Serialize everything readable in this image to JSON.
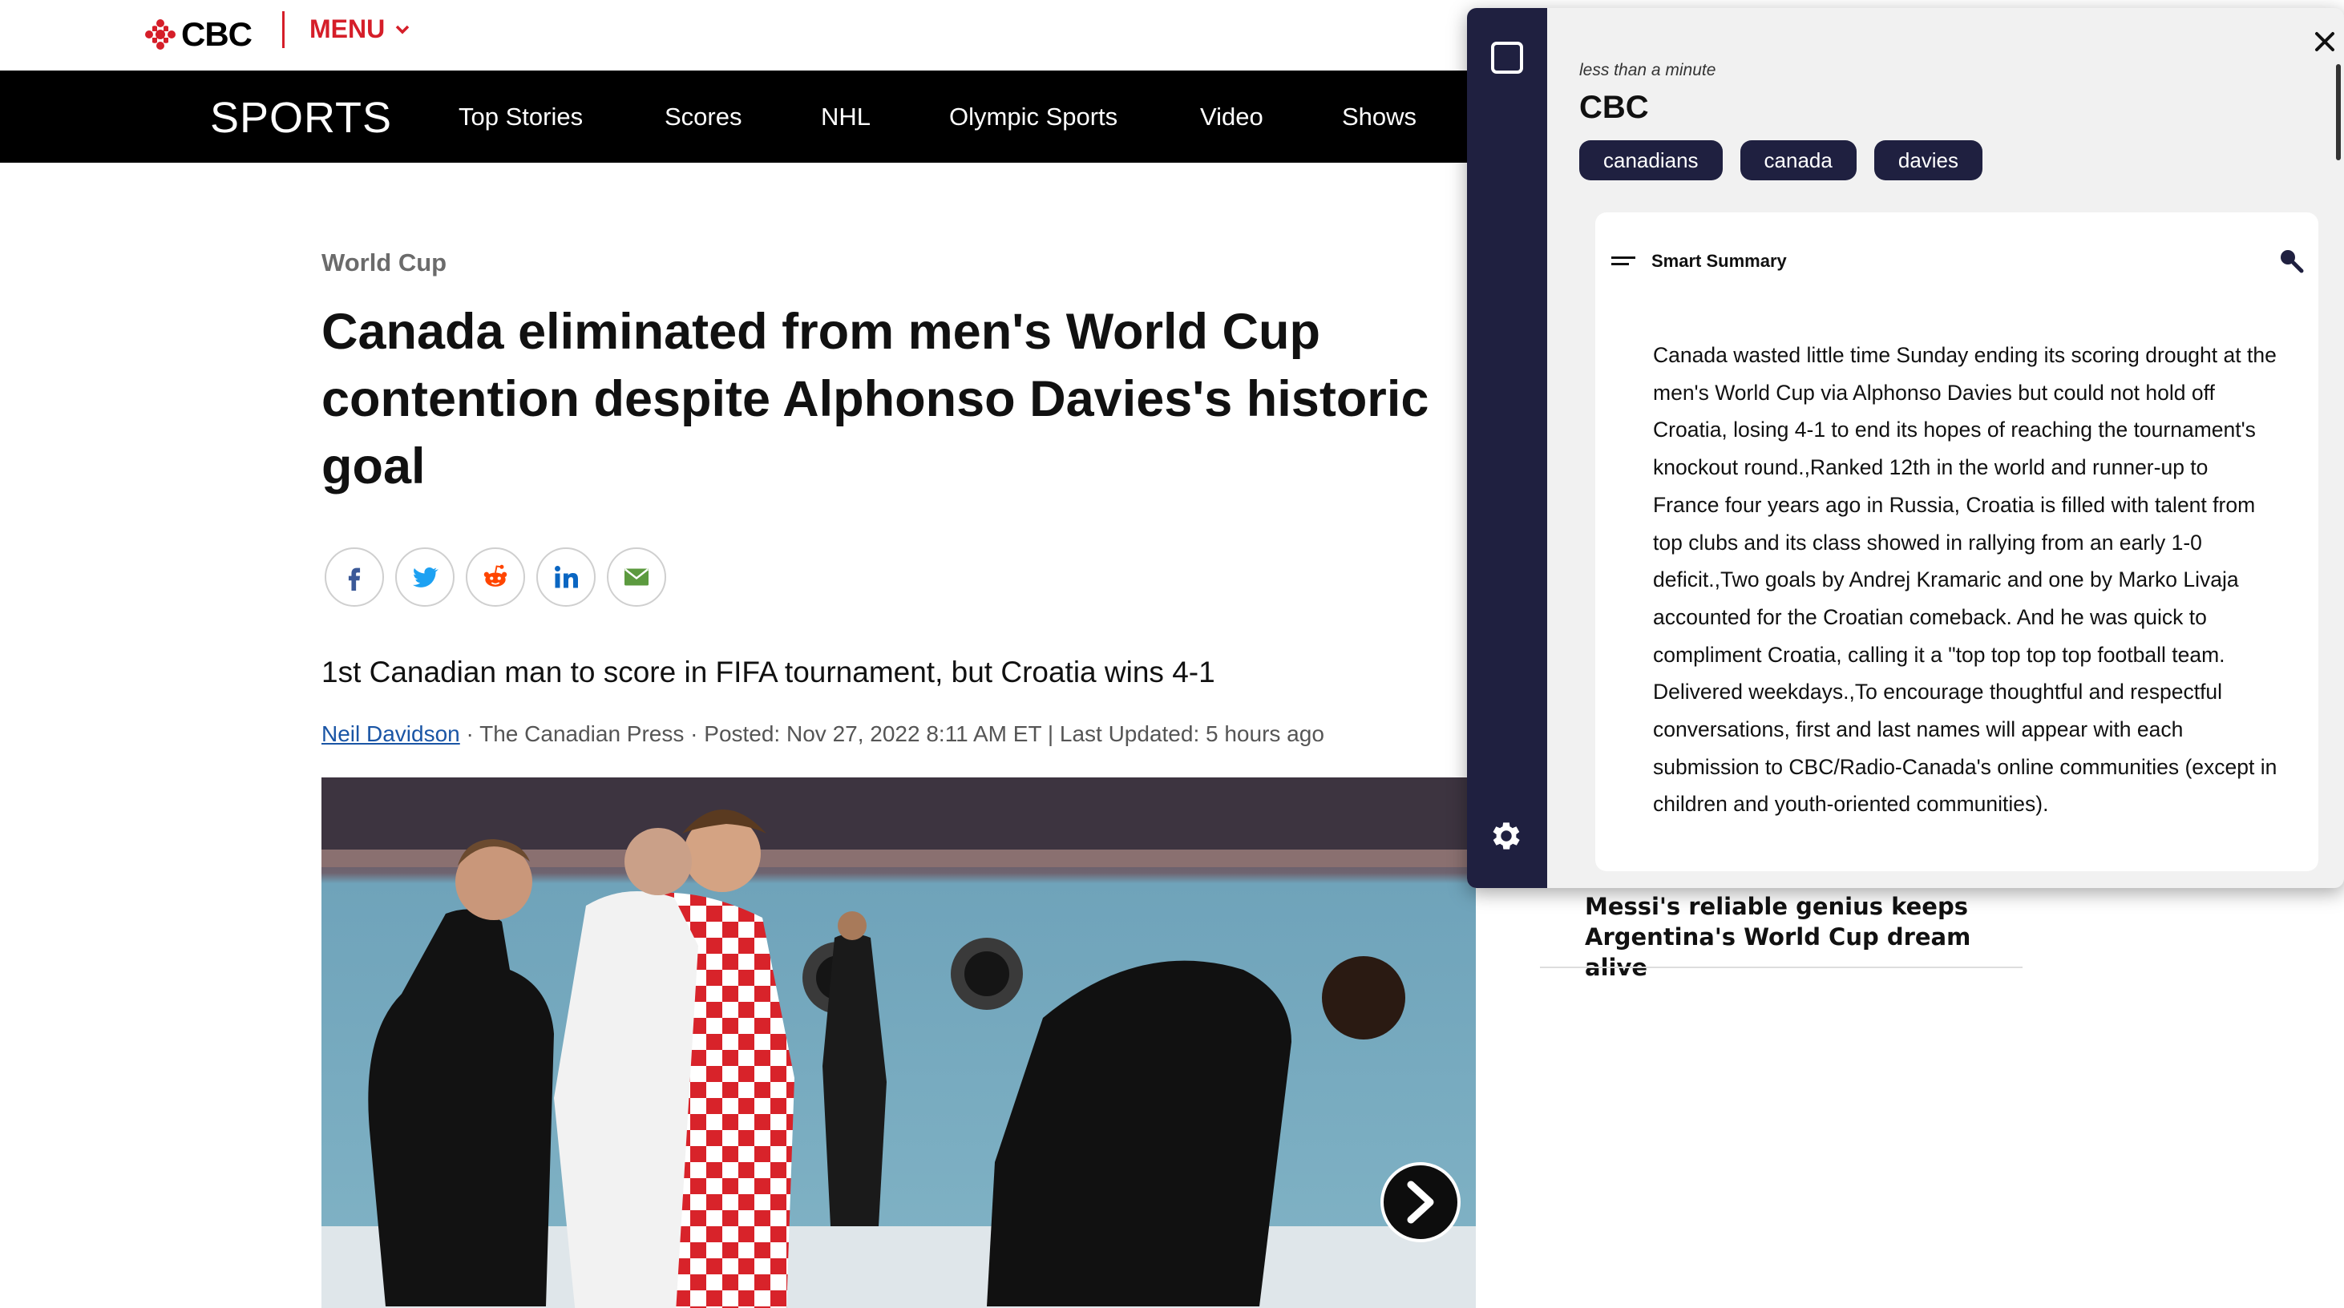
{
  "header": {
    "logo_text": "CBC",
    "menu_label": "MENU"
  },
  "nav": {
    "section_title": "SPORTS",
    "items": [
      "Top Stories",
      "Scores",
      "NHL",
      "Olympic Sports",
      "Video",
      "Shows"
    ]
  },
  "article": {
    "kicker": "World Cup",
    "headline": "Canada eliminated from men's World Cup contention despite Alphonso Davies's historic goal",
    "deck": "1st Canadian man to score in FIFA tournament, but Croatia wins 4-1",
    "author": "Neil Davidson",
    "byline_rest": " · The Canadian Press · Posted: Nov 27, 2022 8:11 AM ET | Last Updated: 5 hours ago",
    "share_icons": [
      "facebook-icon",
      "twitter-icon",
      "reddit-icon",
      "linkedin-icon",
      "email-icon"
    ]
  },
  "related": {
    "headline": "Messi's reliable genius keeps Argentina's World Cup dream alive"
  },
  "panel": {
    "read_time": "less than a minute",
    "source": "CBC",
    "tags": [
      "canadians",
      "canada",
      "davies"
    ],
    "card_title": "Smart Summary",
    "summary": "Canada wasted little time Sunday ending its scoring drought at the men's World Cup via Alphonso Davies but could not hold off Croatia, losing 4-1 to end its hopes of reaching the tournament's knockout round.,Ranked 12th in the world and runner-up to France four years ago in Russia, Croatia is filled with talent from top clubs and its class showed in rallying from an early 1-0 deficit.,Two goals by Andrej Kramaric and one by Marko Livaja accounted for the Croatian comeback. And he was quick to compliment Croatia, calling it a \"top top top top football team. Delivered weekdays.,To encourage thoughtful and respectful conversations, first and last names will appear with each submission to CBC/Radio-Canada's online communities (except in children and youth-oriented communities)."
  },
  "colors": {
    "brand_red": "#d51e29",
    "panel_navy": "#1f2040",
    "link_blue": "#1a55a5"
  }
}
